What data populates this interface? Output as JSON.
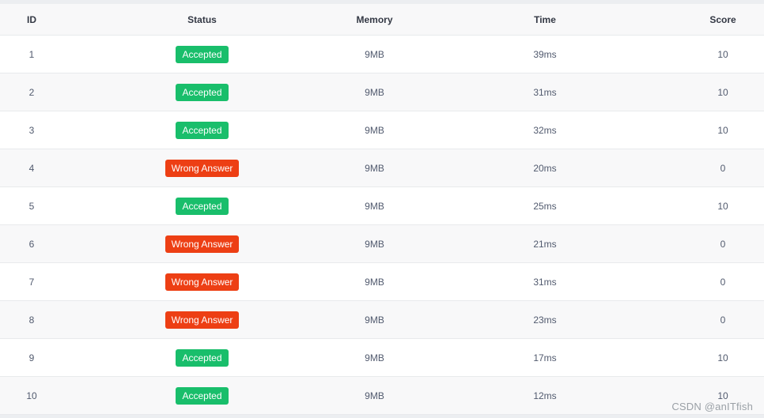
{
  "table": {
    "headers": {
      "id": "ID",
      "status": "Status",
      "memory": "Memory",
      "time": "Time",
      "score": "Score"
    },
    "rows": [
      {
        "id": "1",
        "status": "Accepted",
        "status_type": "accepted",
        "memory": "9MB",
        "time": "39ms",
        "score": "10"
      },
      {
        "id": "2",
        "status": "Accepted",
        "status_type": "accepted",
        "memory": "9MB",
        "time": "31ms",
        "score": "10"
      },
      {
        "id": "3",
        "status": "Accepted",
        "status_type": "accepted",
        "memory": "9MB",
        "time": "32ms",
        "score": "10"
      },
      {
        "id": "4",
        "status": "Wrong Answer",
        "status_type": "wrong",
        "memory": "9MB",
        "time": "20ms",
        "score": "0"
      },
      {
        "id": "5",
        "status": "Accepted",
        "status_type": "accepted",
        "memory": "9MB",
        "time": "25ms",
        "score": "10"
      },
      {
        "id": "6",
        "status": "Wrong Answer",
        "status_type": "wrong",
        "memory": "9MB",
        "time": "21ms",
        "score": "0"
      },
      {
        "id": "7",
        "status": "Wrong Answer",
        "status_type": "wrong",
        "memory": "9MB",
        "time": "31ms",
        "score": "0"
      },
      {
        "id": "8",
        "status": "Wrong Answer",
        "status_type": "wrong",
        "memory": "9MB",
        "time": "23ms",
        "score": "0"
      },
      {
        "id": "9",
        "status": "Accepted",
        "status_type": "accepted",
        "memory": "9MB",
        "time": "17ms",
        "score": "10"
      },
      {
        "id": "10",
        "status": "Accepted",
        "status_type": "accepted",
        "memory": "9MB",
        "time": "12ms",
        "score": "10"
      }
    ]
  },
  "watermark": "CSDN @anITfish",
  "colors": {
    "accepted": "#19be6b",
    "wrong": "#ed3f14",
    "header_bg": "#f8f8f9",
    "border": "#e8eaec"
  }
}
